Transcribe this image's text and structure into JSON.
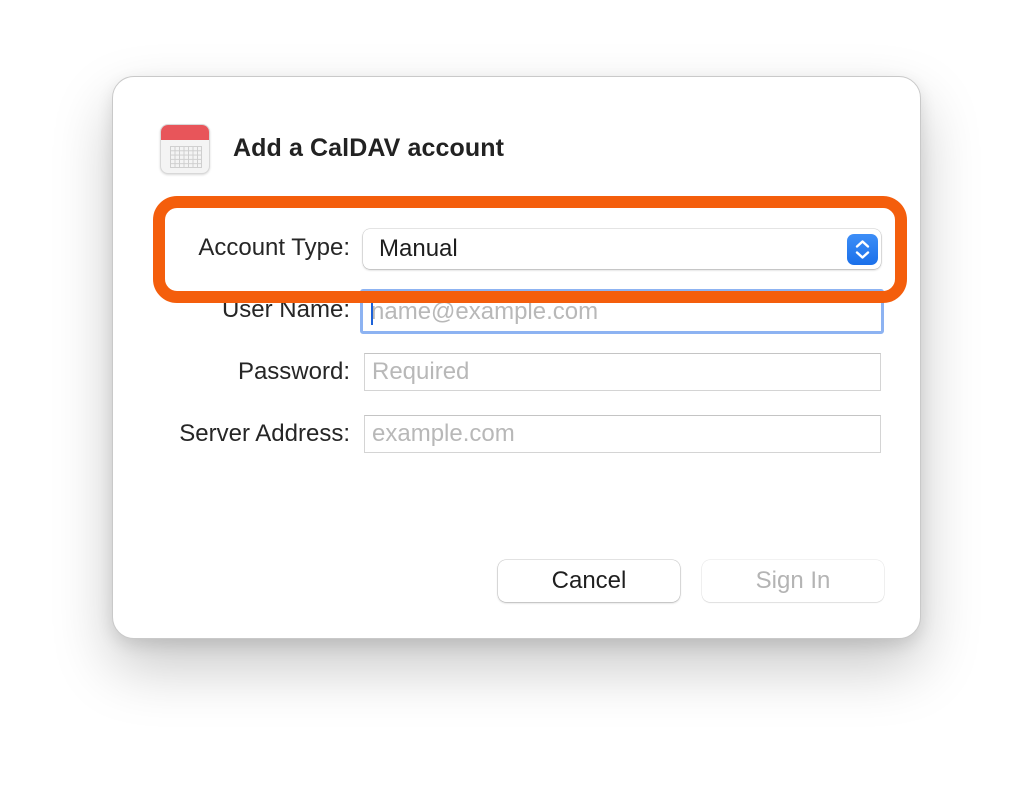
{
  "dialog": {
    "title": "Add a CalDAV account",
    "app_icon": "calendar-icon"
  },
  "form": {
    "account_type": {
      "label": "Account Type:",
      "value": "Manual",
      "icon": "updown-chevron-icon"
    },
    "user_name": {
      "label": "User Name:",
      "value": "",
      "placeholder": "name@example.com"
    },
    "password": {
      "label": "Password:",
      "value": "",
      "placeholder": "Required"
    },
    "server_address": {
      "label": "Server Address:",
      "value": "",
      "placeholder": "example.com"
    }
  },
  "buttons": {
    "cancel_label": "Cancel",
    "sign_in_label": "Sign In"
  },
  "colors": {
    "highlight": "#f45e0c",
    "accent": "#1a70ea",
    "focus_ring": "#8db3f2",
    "calendar_red": "#e8555a"
  }
}
